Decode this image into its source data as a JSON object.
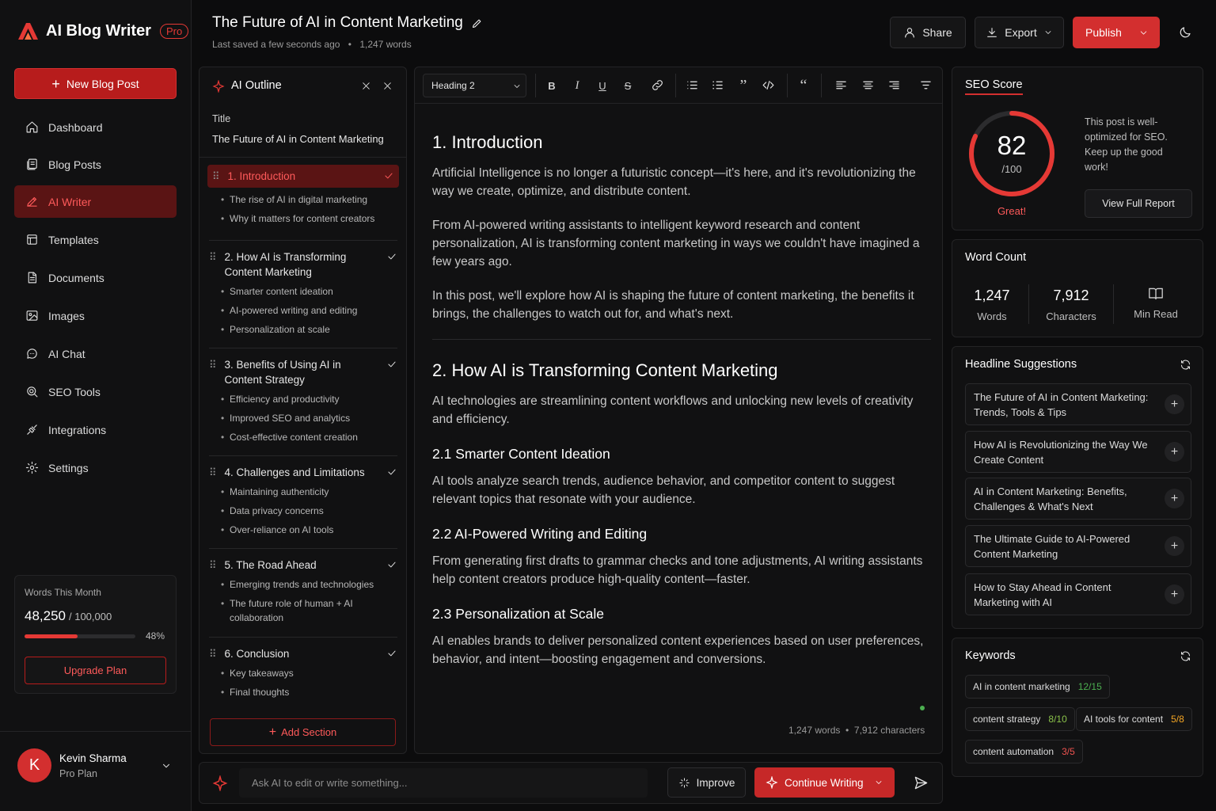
{
  "app": {
    "name": "AI Blog Writer",
    "badge": "Pro"
  },
  "sidebar": {
    "new_button": "New Blog Post",
    "items": [
      {
        "label": "Dashboard",
        "icon": "home-icon"
      },
      {
        "label": "Blog Posts",
        "icon": "blog-posts-icon"
      },
      {
        "label": "AI Writer",
        "icon": "pen-icon",
        "active": true
      },
      {
        "label": "Templates",
        "icon": "templates-icon"
      },
      {
        "label": "Documents",
        "icon": "document-icon"
      },
      {
        "label": "Images",
        "icon": "image-icon"
      },
      {
        "label": "AI Chat",
        "icon": "chat-icon"
      },
      {
        "label": "SEO Tools",
        "icon": "seo-icon"
      },
      {
        "label": "Integrations",
        "icon": "integrations-icon"
      },
      {
        "label": "Settings",
        "icon": "gear-icon"
      }
    ],
    "usage": {
      "label": "Words This Month",
      "used": "48,250",
      "total": "/ 100,000",
      "percent": "48%",
      "fraction": 0.48,
      "upgrade": "Upgrade Plan"
    },
    "user": {
      "initial": "K",
      "name": "Kevin Sharma",
      "plan": "Pro Plan"
    }
  },
  "header": {
    "title": "The Future of AI in Content Marketing",
    "saved": "Last saved a few seconds ago",
    "words": "1,247 words",
    "share": "Share",
    "export": "Export",
    "publish": "Publish"
  },
  "outline": {
    "title": "AI Outline",
    "title_label": "Title",
    "title_value": "The Future of AI in Content Marketing",
    "sections": [
      {
        "heading": "1. Introduction",
        "items": [
          "The rise of AI in digital marketing",
          "Why it matters for content creators"
        ]
      },
      {
        "heading": "2. How AI is Transforming Content Marketing",
        "items": [
          "Smarter content ideation",
          "AI-powered writing and editing",
          "Personalization at scale"
        ]
      },
      {
        "heading": "3. Benefits of Using AI in Content Strategy",
        "items": [
          "Efficiency and productivity",
          "Improved SEO and analytics",
          "Cost-effective content creation"
        ]
      },
      {
        "heading": "4. Challenges and Limitations",
        "items": [
          "Maintaining authenticity",
          "Data privacy concerns",
          "Over-reliance on AI tools"
        ]
      },
      {
        "heading": "5. The Road Ahead",
        "items": [
          "Emerging trends and technologies",
          "The future role of human + AI collaboration"
        ]
      },
      {
        "heading": "6. Conclusion",
        "items": [
          "Key takeaways",
          "Final thoughts"
        ]
      }
    ],
    "add_section": "Add Section"
  },
  "editor": {
    "heading_select": "Heading 2",
    "h1_intro": "1. Introduction",
    "p1": "Artificial Intelligence is no longer a futuristic concept—it's here, and it's revolutionizing the way we create, optimize, and distribute content.",
    "p2": "From AI-powered writing assistants to intelligent keyword research and content personalization, AI is transforming content marketing in ways we couldn't have imagined a few years ago.",
    "p3": "In this post, we'll explore how AI is shaping the future of content marketing, the benefits it brings, the challenges to watch out for, and what's next.",
    "h1_how": "2. How AI is Transforming Content Marketing",
    "p4": "AI technologies are streamlining content workflows and unlocking new levels of creativity and efficiency.",
    "h2_1": "2.1 Smarter Content Ideation",
    "p5": "AI tools analyze search trends, audience behavior, and competitor content to suggest relevant topics that resonate with your audience.",
    "h2_2": "2.2 AI-Powered Writing and Editing",
    "p6": "From generating first drafts to grammar checks and tone adjustments, AI writing assistants help content creators produce high-quality content—faster.",
    "h2_3": "2.3 Personalization at Scale",
    "p7": "AI enables brands to deliver personalized content experiences based on user preferences, behavior, and intent—boosting engagement and conversions.",
    "footer": "1,247 words  •  7,912 characters"
  },
  "seo": {
    "title": "SEO Score",
    "score": "82",
    "max": "/100",
    "score_fraction": 0.82,
    "rating": "Great!",
    "message": "This post is well-optimized for SEO. Keep up the good work!",
    "report": "View Full Report"
  },
  "wordcount": {
    "title": "Word Count",
    "words": "1,247",
    "words_label": "Words",
    "chars": "7,912",
    "chars_label": "Characters",
    "read_label": "Min Read"
  },
  "headlines": {
    "title": "Headline Suggestions",
    "items": [
      "The Future of AI in Content Marketing: Trends, Tools & Tips",
      "How AI is Revolutionizing the Way We Create Content",
      "AI in Content Marketing: Benefits, Challenges & What's Next",
      "The Ultimate Guide to AI-Powered Content Marketing",
      "How to Stay Ahead in Content Marketing with AI"
    ]
  },
  "keywords": {
    "title": "Keywords",
    "items": [
      {
        "text": "AI in content marketing",
        "count": "12/15",
        "color": "#4caf50"
      },
      {
        "text": "content strategy",
        "count": "8/10",
        "color": "#8bc34a"
      },
      {
        "text": "AI tools for content",
        "count": "5/8",
        "color": "#f5a623"
      },
      {
        "text": "content automation",
        "count": "3/5",
        "color": "#ef5350"
      }
    ]
  },
  "askbar": {
    "placeholder": "Ask AI to edit or write something...",
    "improve": "Improve",
    "continue": "Continue Writing"
  },
  "colors": {
    "accent": "#d32f2f",
    "bg": "#0c0c0d",
    "panel": "#111112"
  }
}
